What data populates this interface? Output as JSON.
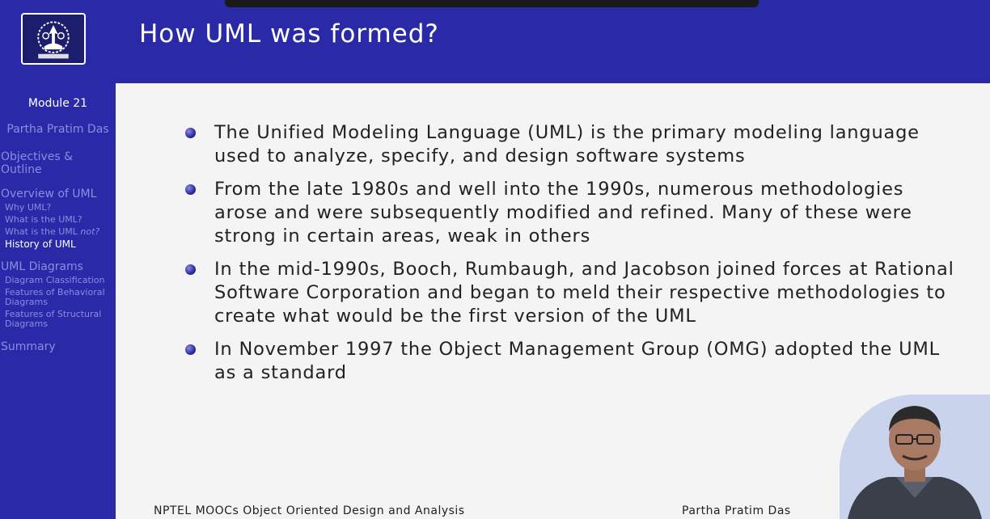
{
  "slide": {
    "title": "How UML was formed?",
    "bullets": [
      "The Unified Modeling Language (UML) is the primary modeling language used to analyze, specify, and design software systems",
      "From the late 1980s and well into the 1990s, numerous methodologies arose and were subsequently modified and refined. Many of these were strong in certain areas, weak in others",
      "In the mid-1990s, Booch, Rumbaugh, and Jacobson joined forces at Rational Software Corporation and began to meld their respective methodologies to create what would be the first version of the UML",
      "In November 1997 the Object Management Group (OMG) adopted the UML as a standard"
    ]
  },
  "sidebar": {
    "module": "Module 21",
    "author": "Partha Pratim Das",
    "sections": {
      "objectives": "Objectives & Outline",
      "overview": "Overview of UML",
      "why_uml": "Why UML?",
      "what_is": "What is the UML?",
      "what_not_prefix": "What is the UML",
      "what_not_suffix": "not?",
      "history": "History of UML",
      "diagrams": "UML Diagrams",
      "classification": "Diagram Classification",
      "behavioral": "Features of Behavioral Diagrams",
      "structural": "Features of Structural Diagrams",
      "summary": "Summary"
    }
  },
  "footer": {
    "course": "NPTEL MOOCs Object Oriented Design and Analysis",
    "author": "Partha Pratim Das"
  },
  "colors": {
    "primary": "#2a2aa8",
    "sidebar_text": "#8c8ce0",
    "background": "#f4f4f4"
  },
  "icons": {
    "logo": "iit-kharagpur-emblem",
    "presenter": "presenter-webcam"
  }
}
